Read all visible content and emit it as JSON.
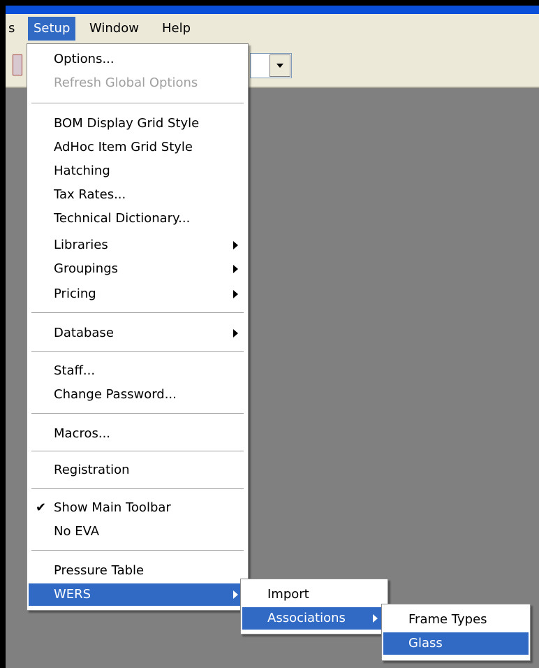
{
  "menubar": {
    "items": [
      {
        "label": "s"
      },
      {
        "label": "Setup"
      },
      {
        "label": "Window"
      },
      {
        "label": "Help"
      }
    ]
  },
  "toolbar": {
    "fragment_icon": "toolbar-button-partial",
    "combo_arrow_icon": "dropdown-arrow"
  },
  "setup_menu": {
    "items": [
      {
        "label": "Options..."
      },
      {
        "label": "Refresh Global Options"
      },
      {
        "label": "BOM Display Grid Style"
      },
      {
        "label": "AdHoc Item Grid Style"
      },
      {
        "label": "Hatching"
      },
      {
        "label": "Tax Rates..."
      },
      {
        "label": "Technical Dictionary..."
      },
      {
        "label": "Libraries"
      },
      {
        "label": "Groupings"
      },
      {
        "label": "Pricing"
      },
      {
        "label": "Database"
      },
      {
        "label": "Staff..."
      },
      {
        "label": "Change Password..."
      },
      {
        "label": "Macros..."
      },
      {
        "label": "Registration"
      },
      {
        "label": "Show Main Toolbar"
      },
      {
        "label": "No EVA"
      },
      {
        "label": "Pressure Table"
      },
      {
        "label": "WERS"
      }
    ]
  },
  "wers_submenu": {
    "items": [
      {
        "label": "Import"
      },
      {
        "label": "Associations"
      }
    ]
  },
  "associations_submenu": {
    "items": [
      {
        "label": "Frame Types"
      },
      {
        "label": "Glass"
      }
    ]
  },
  "colors": {
    "highlight": "#316ac5",
    "menubar_bg": "#ece9d8",
    "workspace_bg": "#808080",
    "titlebar": "#0a4fd8"
  }
}
